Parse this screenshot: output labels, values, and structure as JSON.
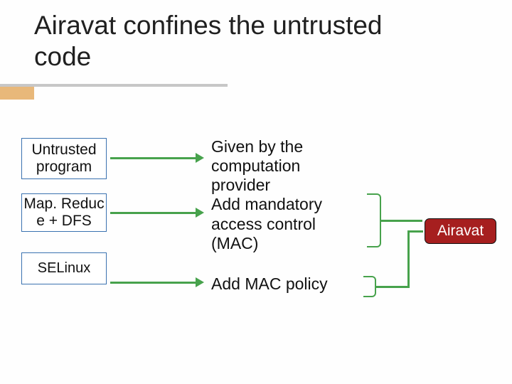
{
  "title": "Airavat confines the untrusted code",
  "boxes": {
    "untrusted": "Untrusted program",
    "mapreduce": "Map. Reduc e + DFS",
    "selinux": "SELinux"
  },
  "descriptions": {
    "d1": "Given by the computation provider\nAdd mandatory access control (MAC)",
    "d2": "Add MAC policy"
  },
  "airavat_label": "Airavat",
  "colors": {
    "box_border": "#3a72b0",
    "arrow": "#47a24c",
    "airavat_bg": "#a61f1f",
    "accent": "#e8b87a"
  }
}
